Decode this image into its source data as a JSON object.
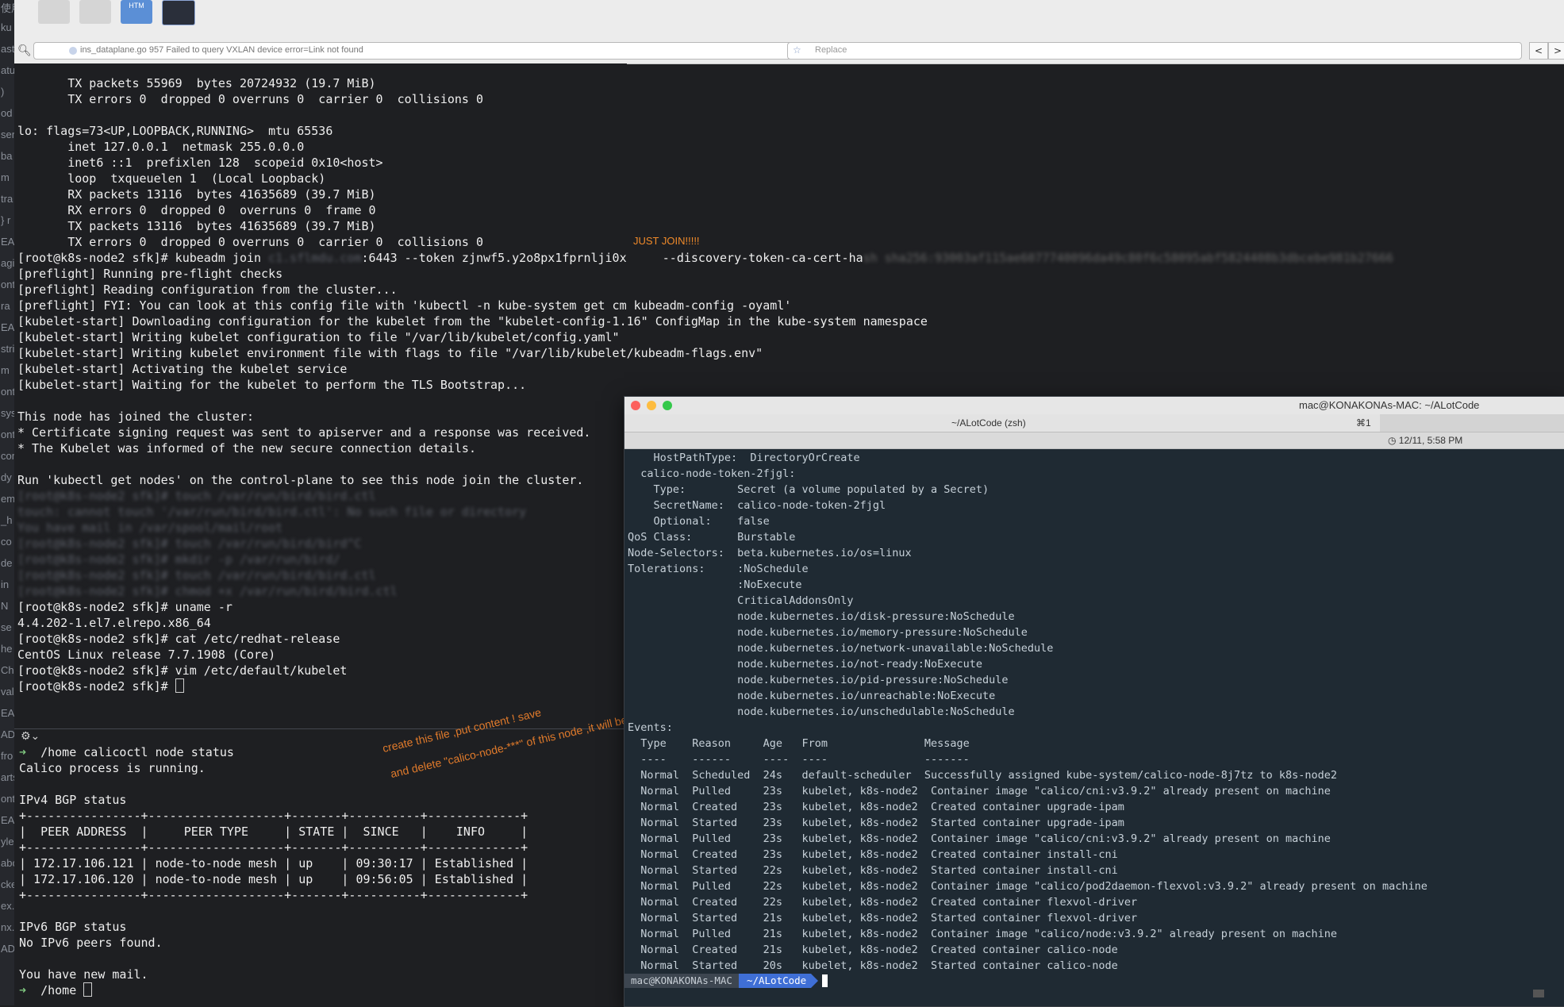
{
  "top_bar": {
    "thumbnails": [
      "",
      "",
      "HTM",
      ""
    ],
    "find_query": "ins_dataplane.go 957 Failed to query VXLAN device error=Link not found",
    "replace_placeholder": "Replace",
    "prev_label": "<",
    "next_label": ">"
  },
  "left_strip": [
    "使用",
    "ku",
    "ast",
    "atu",
    ")",
    "od",
    "ser",
    "ba",
    "m",
    "tra",
    "} r",
    "EA",
    "agi",
    "ont",
    "ra",
    "EA",
    "stri",
    "m",
    "ont",
    "sys",
    "ont",
    "con",
    "dy",
    "em",
    "_h",
    "co",
    "de",
    "in",
    "N",
    "se",
    "he",
    "Ch",
    "val",
    "EA",
    "AD",
    "fro",
    "arts",
    "onte",
    "EA",
    "yle",
    "abo",
    "cke",
    "ex.h",
    "nx.c",
    "ADM"
  ],
  "left_terminal": {
    "pre_lines": [
      "       TX packets 55969  bytes 20724932 (19.7 MiB)",
      "       TX errors 0  dropped 0 overruns 0  carrier 0  collisions 0",
      "",
      "lo: flags=73<UP,LOOPBACK,RUNNING>  mtu 65536",
      "       inet 127.0.0.1  netmask 255.0.0.0",
      "       inet6 ::1  prefixlen 128  scopeid 0x10<host>",
      "       loop  txqueuelen 1  (Local Loopback)",
      "       RX packets 13116  bytes 41635689 (39.7 MiB)",
      "       RX errors 0  dropped 0  overruns 0  frame 0",
      "       TX packets 13116  bytes 41635689 (39.7 MiB)",
      "       TX errors 0  dropped 0 overruns 0  carrier 0  collisions 0",
      ""
    ],
    "join_prefix": "[root@k8s-node2 sfk]# kubeadm join ",
    "join_host": "c1.sflmdu.com",
    "join_mid": ":6443 --token zjnwf5.y2o8px1fprnlji0x     --discovery-token-ca-cert-ha",
    "join_hash": "sh sha256:93003af115ae6077740096da49c80f6c58095abf5824408b3dbcebe981b27666",
    "join_lines": [
      "[preflight] Running pre-flight checks",
      "[preflight] Reading configuration from the cluster...",
      "[preflight] FYI: You can look at this config file with 'kubectl -n kube-system get cm kubeadm-config -oyaml'",
      "[kubelet-start] Downloading configuration for the kubelet from the \"kubelet-config-1.16\" ConfigMap in the kube-system namespace",
      "[kubelet-start] Writing kubelet configuration to file \"/var/lib/kubelet/config.yaml\"",
      "[kubelet-start] Writing kubelet environment file with flags to file \"/var/lib/kubelet/kubeadm-flags.env\"",
      "[kubelet-start] Activating the kubelet service",
      "[kubelet-start] Waiting for the kubelet to perform the TLS Bootstrap...",
      "",
      "This node has joined the cluster:",
      "* Certificate signing request was sent to apiserver and a response was received.",
      "* The Kubelet was informed of the new secure connection details.",
      "",
      "Run 'kubectl get nodes' on the control-plane to see this node join the cluster.",
      ""
    ],
    "blurred_lines": [
      "[root@k8s-node2 sfk]# touch /var/run/bird/bird.ctl",
      "touch: cannot touch '/var/run/bird/bird.ctl': No such file or directory",
      "You have mail in /var/spool/mail/root",
      "[root@k8s-node2 sfk]# touch /var/run/bird/bird^C",
      "[root@k8s-node2 sfk]# mkdir -p /var/run/bird/",
      "[root@k8s-node2 sfk]# touch /var/run/bird/bird.ctl",
      "[root@k8s-node2 sfk]# chmod +x /var/run/bird/bird.ctl"
    ],
    "tail_lines": [
      "[root@k8s-node2 sfk]# uname -r",
      "4.4.202-1.el7.elrepo.x86_64",
      "[root@k8s-node2 sfk]# cat /etc/redhat-release",
      "CentOS Linux release 7.7.1908 (Core)",
      "[root@k8s-node2 sfk]# vim /etc/default/kubelet"
    ],
    "last_prompt": "[root@k8s-node2 sfk]# ",
    "note_join": "JUST JOIN!!!!!"
  },
  "lower_pane": {
    "gear_label": "⚙⌄",
    "arrow": "➜",
    "cwd": "/home",
    "command": "calicoctl node status",
    "lines_before_table": [
      "Calico process is running.",
      "",
      "IPv4 BGP status"
    ],
    "table_lines": [
      "+----------------+-------------------+-------+----------+-------------+",
      "|  PEER ADDRESS  |     PEER TYPE     | STATE |  SINCE   |    INFO     |",
      "+----------------+-------------------+-------+----------+-------------+",
      "| 172.17.106.121 | node-to-node mesh | up    | 09:30:17 | Established |",
      "| 172.17.106.120 | node-to-node mesh | up    | 09:56:05 | Established |",
      "+----------------+-------------------+-------+----------+-------------+"
    ],
    "lines_after_table": [
      "",
      "IPv6 BGP status",
      "No IPv6 peers found.",
      "",
      "You have new mail."
    ],
    "final_cwd": "/home",
    "annotation_line1": "create this file ,put content ! save",
    "annotation_line2": "and delete \"calico-node-***\" of this node ,it will be nice!"
  },
  "right_window": {
    "title": "mac@KONAKONAs-MAC: ~/ALotCode",
    "tab_title": "~/ALotCode (zsh)",
    "tab_shortcut": "⌘1",
    "clock": "◷ 12/11, 5:58 PM",
    "lines": [
      "    HostPathType:  DirectoryOrCreate",
      "  calico-node-token-2fjgl:",
      "    Type:        Secret (a volume populated by a Secret)",
      "    SecretName:  calico-node-token-2fjgl",
      "    Optional:    false",
      "QoS Class:       Burstable",
      "Node-Selectors:  beta.kubernetes.io/os=linux",
      "Tolerations:     :NoSchedule",
      "                 :NoExecute",
      "                 CriticalAddonsOnly",
      "                 node.kubernetes.io/disk-pressure:NoSchedule",
      "                 node.kubernetes.io/memory-pressure:NoSchedule",
      "                 node.kubernetes.io/network-unavailable:NoSchedule",
      "                 node.kubernetes.io/not-ready:NoExecute",
      "                 node.kubernetes.io/pid-pressure:NoSchedule",
      "                 node.kubernetes.io/unreachable:NoExecute",
      "                 node.kubernetes.io/unschedulable:NoSchedule",
      "Events:",
      "  Type    Reason     Age   From               Message",
      "  ----    ------     ----  ----               -------",
      "  Normal  Scheduled  24s   default-scheduler  Successfully assigned kube-system/calico-node-8j7tz to k8s-node2",
      "  Normal  Pulled     23s   kubelet, k8s-node2  Container image \"calico/cni:v3.9.2\" already present on machine",
      "  Normal  Created    23s   kubelet, k8s-node2  Created container upgrade-ipam",
      "  Normal  Started    23s   kubelet, k8s-node2  Started container upgrade-ipam",
      "  Normal  Pulled     23s   kubelet, k8s-node2  Container image \"calico/cni:v3.9.2\" already present on machine",
      "  Normal  Created    23s   kubelet, k8s-node2  Created container install-cni",
      "  Normal  Started    22s   kubelet, k8s-node2  Started container install-cni",
      "  Normal  Pulled     22s   kubelet, k8s-node2  Container image \"calico/pod2daemon-flexvol:v3.9.2\" already present on machine",
      "  Normal  Created    22s   kubelet, k8s-node2  Created container flexvol-driver",
      "  Normal  Started    21s   kubelet, k8s-node2  Started container flexvol-driver",
      "  Normal  Pulled     21s   kubelet, k8s-node2  Container image \"calico/node:v3.9.2\" already present on machine",
      "  Normal  Created    21s   kubelet, k8s-node2  Created container calico-node",
      "  Normal  Started    20s   kubelet, k8s-node2  Started container calico-node"
    ],
    "prompt_user": "mac@KONAKONAs-MAC",
    "prompt_dir": "~/ALotCode"
  }
}
